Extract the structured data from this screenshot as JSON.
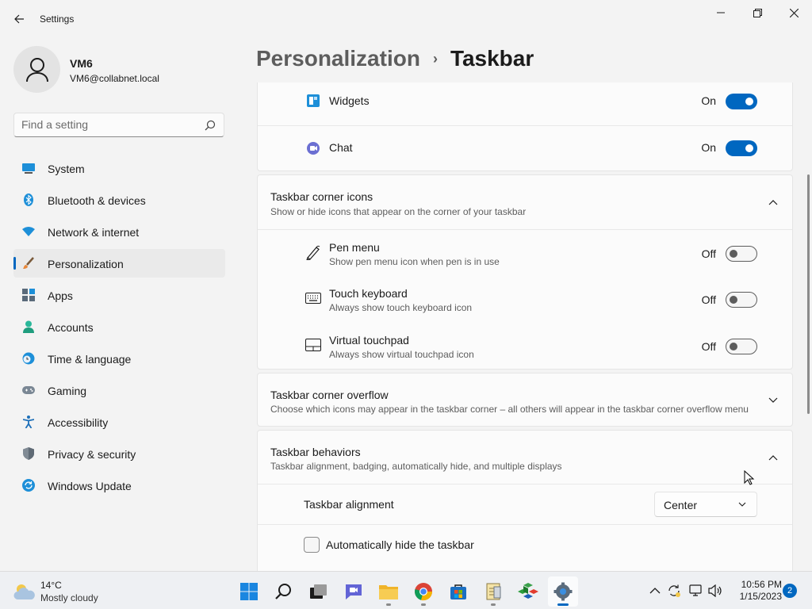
{
  "app": {
    "title": "Settings"
  },
  "profile": {
    "name": "VM6",
    "email": "VM6@collabnet.local"
  },
  "search": {
    "placeholder": "Find a setting"
  },
  "nav": {
    "items": [
      {
        "label": "System",
        "icon": "system-icon"
      },
      {
        "label": "Bluetooth & devices",
        "icon": "bluetooth-icon"
      },
      {
        "label": "Network & internet",
        "icon": "network-icon"
      },
      {
        "label": "Personalization",
        "icon": "paintbrush-icon",
        "selected": true
      },
      {
        "label": "Apps",
        "icon": "apps-icon"
      },
      {
        "label": "Accounts",
        "icon": "accounts-icon"
      },
      {
        "label": "Time & language",
        "icon": "clock-globe-icon"
      },
      {
        "label": "Gaming",
        "icon": "gamepad-icon"
      },
      {
        "label": "Accessibility",
        "icon": "accessibility-icon"
      },
      {
        "label": "Privacy & security",
        "icon": "shield-icon"
      },
      {
        "label": "Windows Update",
        "icon": "windows-update-icon"
      }
    ]
  },
  "header": {
    "parent": "Personalization",
    "separator": "›",
    "current": "Taskbar"
  },
  "taskbar_items": {
    "widgets": {
      "label": "Widgets",
      "state": "On"
    },
    "chat": {
      "label": "Chat",
      "state": "On"
    }
  },
  "corner_icons": {
    "title": "Taskbar corner icons",
    "subtitle": "Show or hide icons that appear on the corner of your taskbar",
    "expanded": true,
    "items": [
      {
        "title": "Pen menu",
        "subtitle": "Show pen menu icon when pen is in use",
        "state": "Off"
      },
      {
        "title": "Touch keyboard",
        "subtitle": "Always show touch keyboard icon",
        "state": "Off"
      },
      {
        "title": "Virtual touchpad",
        "subtitle": "Always show virtual touchpad icon",
        "state": "Off"
      }
    ]
  },
  "corner_overflow": {
    "title": "Taskbar corner overflow",
    "subtitle": "Choose which icons may appear in the taskbar corner – all others will appear in the taskbar corner overflow menu",
    "expanded": false
  },
  "behaviors": {
    "title": "Taskbar behaviors",
    "subtitle": "Taskbar alignment, badging, automatically hide, and multiple displays",
    "expanded": true,
    "alignment_label": "Taskbar alignment",
    "alignment_value": "Center",
    "autohide_label": "Automatically hide the taskbar",
    "autohide_checked": false
  },
  "os_taskbar": {
    "weather": {
      "temp": "14°C",
      "desc": "Mostly cloudy"
    },
    "apps": [
      "windows-start-icon",
      "search-icon",
      "task-view-icon",
      "teams-chat-icon",
      "file-explorer-icon",
      "chrome-icon",
      "store-icon",
      "notepad-icon",
      "app-cube-icon",
      "settings-gear-icon"
    ],
    "time": "10:56 PM",
    "date": "1/15/2023",
    "notifications": "2"
  },
  "colors": {
    "accent": "#0067c0",
    "background": "#f3f3f3",
    "card": "#fbfbfb"
  }
}
